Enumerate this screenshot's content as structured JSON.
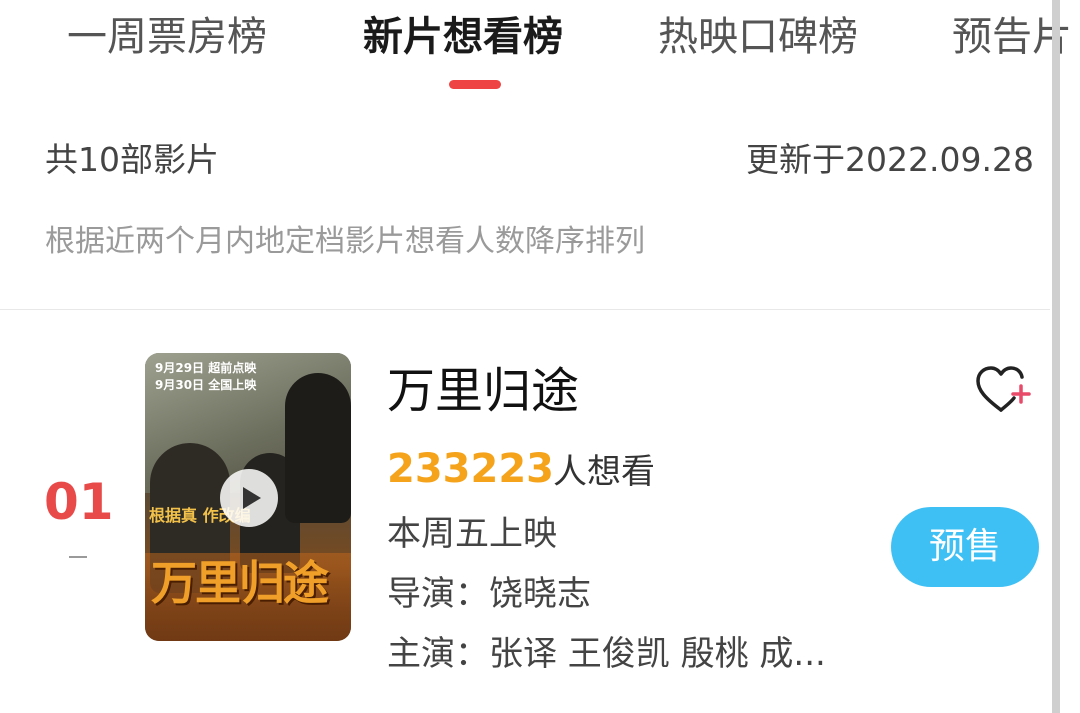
{
  "tabs": [
    {
      "label": "一周票房榜",
      "active": false
    },
    {
      "label": "新片想看榜",
      "active": true
    },
    {
      "label": "热映口碑榜",
      "active": false
    },
    {
      "label": "预告片",
      "active": false
    }
  ],
  "summary": {
    "count_text": "共10部影片",
    "updated_text": "更新于2022.09.28",
    "description": "根据近两个月内地定档影片想看人数降序排列"
  },
  "movies": [
    {
      "rank": "01",
      "rank_change": "–",
      "title": "万里归途",
      "wish_count": "233223",
      "wish_suffix": "人想看",
      "release": "本周五上映",
      "director": "导演：饶晓志",
      "actors": "主演：张译 王俊凯 殷桃 成...",
      "button_label": "预售",
      "poster": {
        "date_line_1": "9月29日 超前点映",
        "date_line_2": "9月30日 全国上映",
        "tagline": "根据真     作改编",
        "title": "万里归途"
      }
    }
  ],
  "colors": {
    "accent_red": "#ef4444",
    "rank_red": "#e84a4a",
    "wish_orange": "#f5a31a",
    "presale_blue": "#3fc0f5"
  },
  "icons": {
    "favorite": "heart-plus-icon",
    "play": "play-icon"
  }
}
